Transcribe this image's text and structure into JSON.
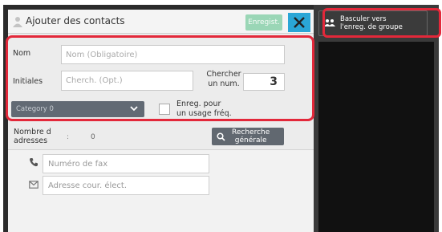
{
  "window": {
    "title": "Ajouter des contacts",
    "save_label": "Enregist.",
    "close_label": "✕"
  },
  "form": {
    "name_label": "Nom",
    "name_placeholder": "Nom (Obligatoire)",
    "initials_label": "Initiales",
    "initials_placeholder": "Cherch. (Opt.)",
    "search_number_label_line1": "Chercher",
    "search_number_label_line2": "un num.",
    "search_number_value": "3",
    "category_value": "Category 0",
    "frequent_label_line1": "Enreg. pour",
    "frequent_label_line2": "un usage fréq.",
    "frequent_checked": false
  },
  "address_count": {
    "label_line1": "Nombre d",
    "label_line2": "adresses",
    "separator": ":",
    "value": "0"
  },
  "global_search": {
    "label_line1": "Recherche",
    "label_line2": "générale"
  },
  "contacts": {
    "fax_placeholder": "Numéro de fax",
    "email_placeholder": "Adresse cour. élect."
  },
  "group_switch": {
    "label_line1": "Basculer vers",
    "label_line2": "l'enreg. de groupe"
  },
  "colors": {
    "highlight": "#e3283a",
    "close_button": "#2aa6d6",
    "save_button": "#9ad6b6",
    "category_bg": "#626a74"
  },
  "icons": {
    "title": "person-icon",
    "fax": "phone-icon",
    "email": "envelope-icon",
    "search": "search-icon",
    "group": "group-icon",
    "category": "chevron-down-icon"
  }
}
